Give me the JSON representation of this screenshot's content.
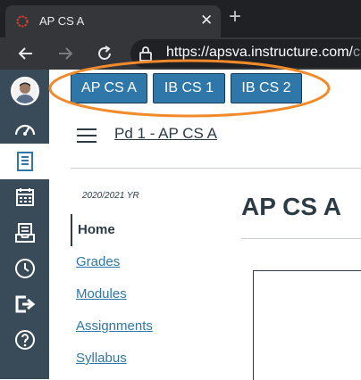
{
  "browser": {
    "tab_title": "AP CS A",
    "new_tab_icon": "plus-icon",
    "url_host": "https://apsva.instructure.com/",
    "url_rest": "c"
  },
  "global_nav": {
    "items": [
      "avatar",
      "dashboard-icon",
      "courses-icon",
      "calendar-icon",
      "inbox-icon",
      "history-icon",
      "commons-icon",
      "help-icon"
    ],
    "active": "courses-icon"
  },
  "course_buttons": [
    "AP CS A",
    "IB CS 1",
    "IB CS 2"
  ],
  "highlight_color": "#f08a2a",
  "breadcrumb": "Pd 1 - AP CS A",
  "term": "2020/2021 YR",
  "course_title": "AP CS A",
  "course_nav": [
    "Home",
    "Grades",
    "Modules",
    "Assignments",
    "Syllabus"
  ],
  "course_nav_active": "Home",
  "colors": {
    "nav_bg": "#394b58",
    "button_bg": "#2e77a8",
    "link": "#2e77a8",
    "text": "#2d3b45"
  }
}
